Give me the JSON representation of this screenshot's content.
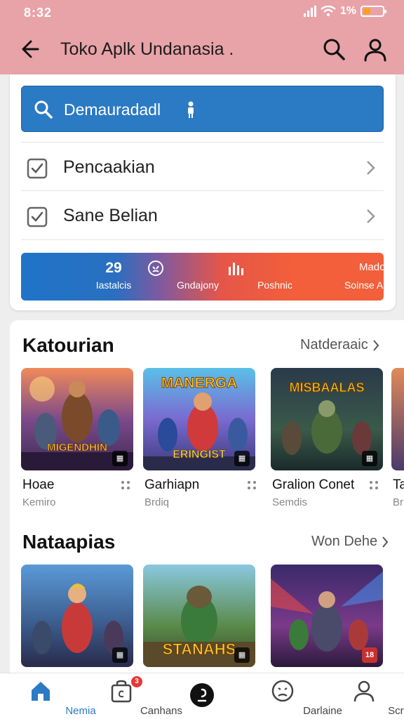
{
  "status": {
    "time": "8:32",
    "battery": "1%"
  },
  "appbar": {
    "title": "Toko Aplk Undanasia ."
  },
  "search": {
    "text": "Demauradadl"
  },
  "rows": [
    {
      "label": "Pencaakian"
    },
    {
      "label": "Sane Belian"
    }
  ],
  "promo": [
    {
      "value": "29",
      "label": "Iastalcis"
    },
    {
      "label": "Gndajony",
      "icon": "clock-icon"
    },
    {
      "label": "Poshnic",
      "icon": "bar-chart-icon"
    },
    {
      "value": "Madoedny",
      "label": "Soinse Ahlananns"
    }
  ],
  "section1": {
    "title": "Katourian",
    "link": "Natderaaic",
    "games": [
      {
        "name": "Hoae",
        "sub": "Kemiro",
        "art_text": "MIGENDHIN"
      },
      {
        "name": "Garhiapn",
        "sub": "Brdiq",
        "art_top": "MANERGA",
        "art_text": "ERINGIST"
      },
      {
        "name": "Gralion Conet",
        "sub": "Semdis",
        "art_text": "MISBAALAS"
      },
      {
        "name": "Ta",
        "sub": "Br"
      }
    ]
  },
  "section2": {
    "title": "Nataapias",
    "link": "Won Dehe",
    "games": [
      {
        "art_text": ""
      },
      {
        "art_text": "STANAHS"
      },
      {
        "art_text": ""
      }
    ]
  },
  "bottomnav": [
    {
      "label": "Nemia",
      "icon": "home-icon",
      "active": true
    },
    {
      "label": "Canhans",
      "icon": "bag-icon",
      "badge": "3"
    },
    {
      "label": "",
      "icon": "center-dot-icon"
    },
    {
      "label": "Darlaine",
      "icon": "face-icon"
    },
    {
      "label": "Scriplo",
      "icon": "person-icon"
    }
  ],
  "colors": {
    "appbar": "#e8a3a8",
    "primary": "#2b7ac4",
    "promo_orange": "#f25f3a"
  }
}
